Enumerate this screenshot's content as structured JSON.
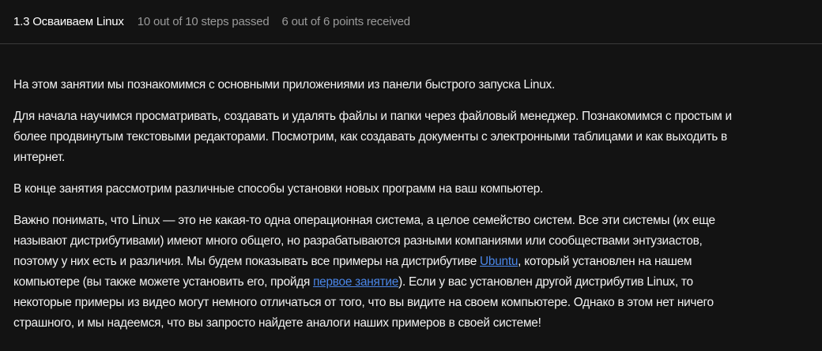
{
  "header": {
    "title": "1.3 Осваиваем Linux",
    "steps": "10 out of 10 steps passed",
    "points": "6 out of 6 points  received"
  },
  "paragraphs": [
    [
      "На этом занятии мы познакомимся с основными приложениями из панели быстрого запуска Linux."
    ],
    [
      "Для начала научимся просматривать, создавать и удалять файлы и папки через файловый менеджер. Познакомимся с простым и",
      "более продвинутым текстовыми редакторами. Посмотрим, как создавать документы с электронными таблицами и как выходить в",
      "интернет."
    ],
    [
      "В конце занятия рассмотрим различные способы установки новых программ на ваш компьютер."
    ],
    {
      "l1": "Важно понимать, что Linux — это не какая-то одна операционная система, а целое семейство систем. Все эти системы (их еще",
      "l2": "называют дистрибутивами) имеют много общего, но разрабатываются разными компаниями или сообществами энтузиастов,",
      "l3a": "поэтому у них есть и различия. Мы будем показывать все примеры на дистрибутиве ",
      "link1": "Ubuntu",
      "l3b": ", который установлен на нашем",
      "l4a": "компьютере (вы также можете установить его, пройдя ",
      "link2": "первое занятие",
      "l4b": ").  Если у вас установлен другой дистрибутив Linux, то",
      "l5": "некоторые примеры из видео могут немного отличаться от того, что вы видите на своем компьютере. Однако в этом нет ничего",
      "l6": "страшного, и мы надеемся, что вы запросто найдете аналоги наших примеров в своей системе!"
    }
  ]
}
